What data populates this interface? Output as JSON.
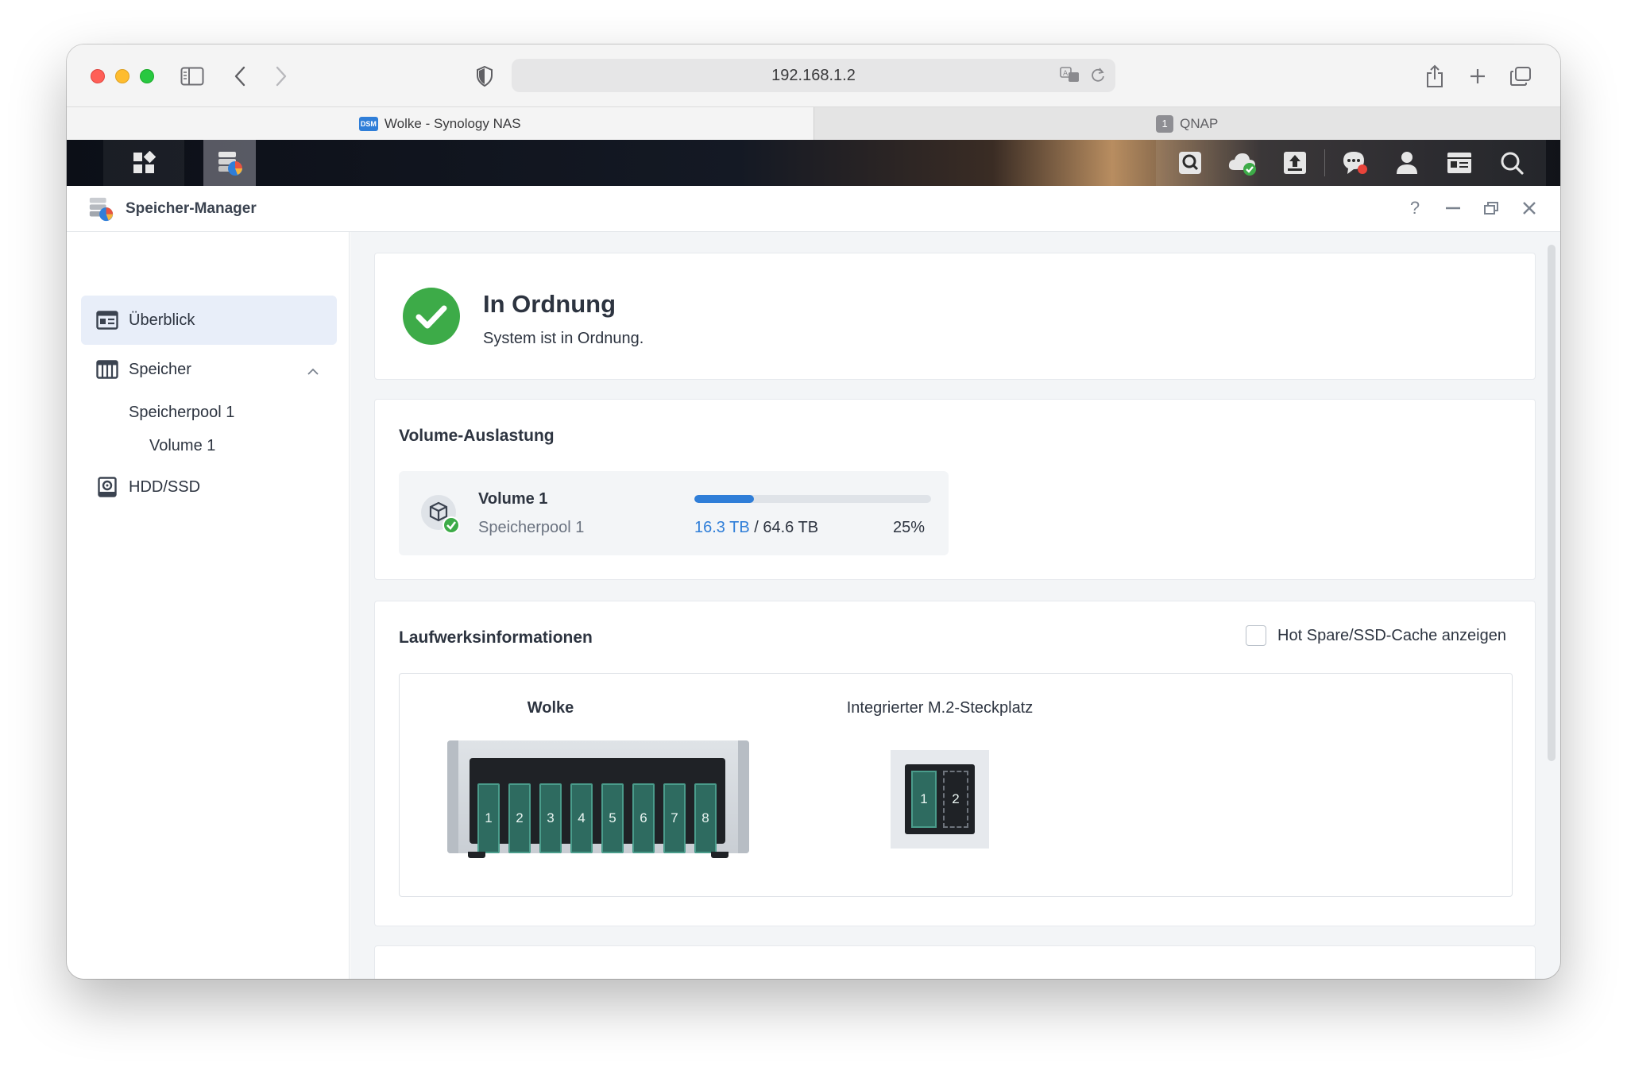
{
  "browser": {
    "address": "192.168.1.2",
    "tabs": [
      {
        "label": "Wolke - Synology NAS",
        "favicon": "DSM",
        "active": true
      },
      {
        "label": "QNAP",
        "favicon": "1",
        "active": false
      }
    ]
  },
  "app": {
    "title": "Speicher-Manager",
    "controls": {
      "help": "?"
    }
  },
  "sidebar": {
    "items": [
      {
        "label": "Überblick",
        "icon": "overview-icon",
        "active": true
      },
      {
        "label": "Speicher",
        "icon": "storage-icon",
        "expanded": true
      },
      {
        "label": "HDD/SSD",
        "icon": "hdd-icon"
      }
    ],
    "storage_pool": "Speicherpool 1",
    "volume": "Volume 1"
  },
  "status": {
    "title": "In Ordnung",
    "subtitle": "System ist in Ordnung."
  },
  "volume_usage": {
    "heading": "Volume-Auslastung",
    "volume_name": "Volume 1",
    "pool_name": "Speicherpool 1",
    "used": "16.3 TB",
    "separator": "/",
    "total": "64.6 TB",
    "percent": "25%",
    "fill_fraction": 0.25,
    "accent_color": "#2f7ed8"
  },
  "drive_info": {
    "heading": "Laufwerksinformationen",
    "hot_spare_label": "Hot Spare/SSD-Cache anzeigen",
    "hot_spare_checked": false,
    "nas_name": "Wolke",
    "bays": [
      "1",
      "2",
      "3",
      "4",
      "5",
      "6",
      "7",
      "8"
    ],
    "m2_label": "Integrierter M.2-Steckplatz",
    "m2_slots": [
      "1",
      "2"
    ]
  }
}
